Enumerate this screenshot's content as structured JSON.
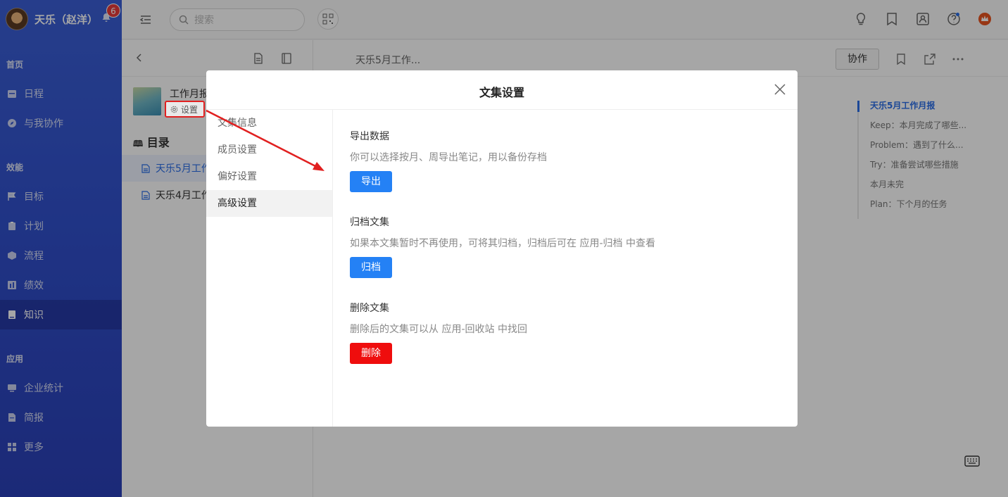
{
  "sidebar": {
    "username": "天乐（赵洋）",
    "notification_count": "6",
    "sections": {
      "home": "首页",
      "efficiency": "效能",
      "apps": "应用"
    },
    "items": [
      {
        "label": "日程",
        "icon": "calendar-icon"
      },
      {
        "label": "与我协作",
        "icon": "compass-icon"
      },
      {
        "label": "目标",
        "icon": "flag-icon"
      },
      {
        "label": "计划",
        "icon": "clipboard-icon"
      },
      {
        "label": "流程",
        "icon": "cube-icon"
      },
      {
        "label": "绩效",
        "icon": "chart-icon"
      },
      {
        "label": "知识",
        "icon": "book-icon",
        "active": true
      },
      {
        "label": "企业统计",
        "icon": "monitor-icon"
      },
      {
        "label": "简报",
        "icon": "report-icon"
      },
      {
        "label": "更多",
        "icon": "grid-icon"
      }
    ]
  },
  "topbar": {
    "search_placeholder": "搜索"
  },
  "collection": {
    "title": "工作月报",
    "settings_label": "设置",
    "toc_title": "目录",
    "toc_items": [
      "天乐5月工作",
      "天乐4月工作"
    ]
  },
  "doc": {
    "title": "天乐5月工作...",
    "collab_label": "协作",
    "outline": [
      "天乐5月工作月报",
      "Keep：本月完成了哪些...",
      "Problem：遇到了什么...",
      "Try：准备尝试哪些措施",
      "本月未完",
      "Plan：下个月的任务"
    ]
  },
  "modal": {
    "title": "文集设置",
    "nav": [
      "文集信息",
      "成员设置",
      "偏好设置",
      "高级设置"
    ],
    "active_nav": "高级设置",
    "sections": [
      {
        "title": "导出数据",
        "desc": "你可以选择按月、周导出笔记，用以备份存档",
        "button": "导出"
      },
      {
        "title": "归档文集",
        "desc": "如果本文集暂时不再使用，可将其归档，归档后可在 应用-归档 中查看",
        "button": "归档"
      },
      {
        "title": "删除文集",
        "desc": "删除后的文集可以从 应用-回收站 中找回",
        "button": "删除"
      }
    ]
  },
  "colors": {
    "accent": "#2481f5",
    "danger": "#ef0d0d",
    "sidebar": "#3150cc",
    "annotation": "#e12020"
  }
}
